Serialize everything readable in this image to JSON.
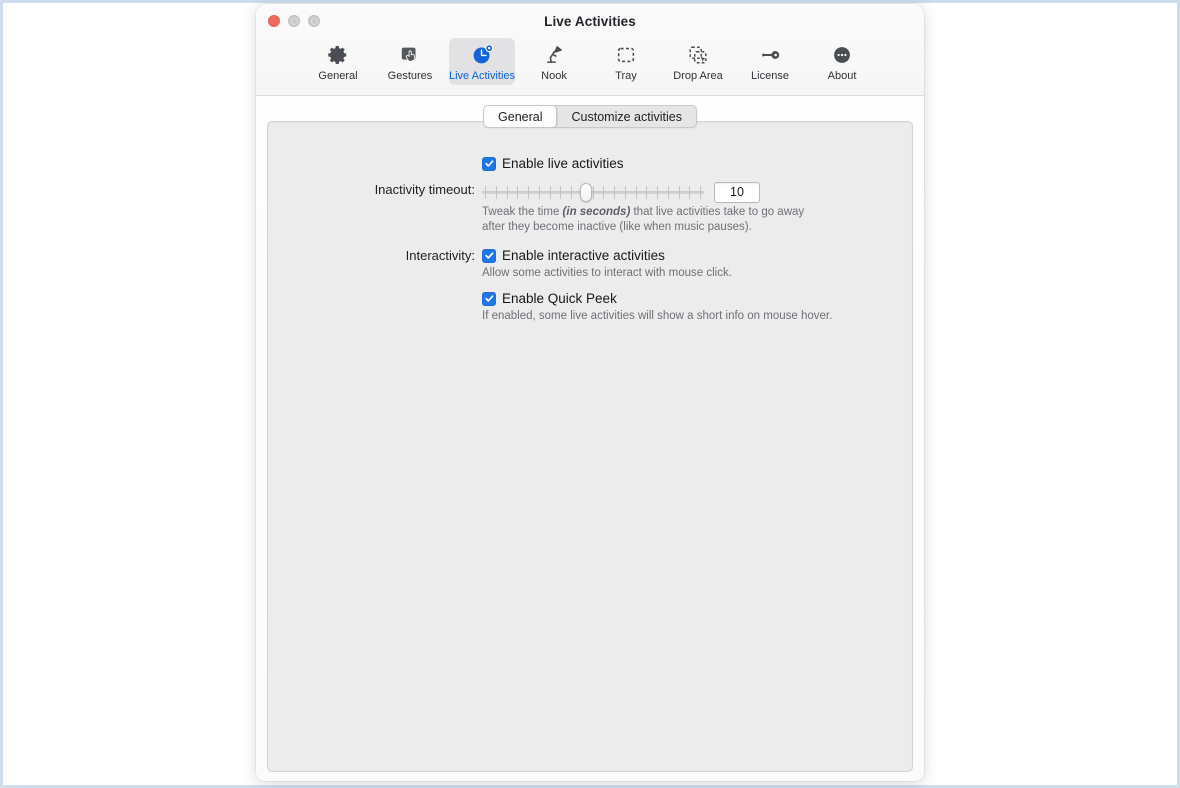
{
  "window": {
    "title": "Live Activities",
    "traffic_lights": [
      "close-button",
      "minimize-button",
      "zoom-button"
    ]
  },
  "toolbar": {
    "items": [
      {
        "label": "General",
        "icon": "gear-icon",
        "selected": false
      },
      {
        "label": "Gestures",
        "icon": "hand-gesture-icon",
        "selected": false
      },
      {
        "label": "Live Activities",
        "icon": "live-activity-clock-icon",
        "selected": true
      },
      {
        "label": "Nook",
        "icon": "desk-lamp-icon",
        "selected": false
      },
      {
        "label": "Tray",
        "icon": "dashed-square-icon",
        "selected": false
      },
      {
        "label": "Drop Area",
        "icon": "drop-area-icon",
        "selected": false
      },
      {
        "label": "License",
        "icon": "key-icon",
        "selected": false
      },
      {
        "label": "About",
        "icon": "ellipsis-circle-icon",
        "selected": false
      }
    ]
  },
  "tabs": [
    {
      "label": "General",
      "active": true
    },
    {
      "label": "Customize activities",
      "active": false
    }
  ],
  "settings": {
    "enable_live_activities": {
      "label": "Enable live activities",
      "checked": true
    },
    "inactivity_timeout": {
      "label": "Inactivity timeout:",
      "value": "10",
      "slider_percent": 47,
      "tick_count": 21,
      "hint_line1_a": "Tweak the time ",
      "hint_line1_em": "(in seconds)",
      "hint_line1_b": " that live activities take to go away",
      "hint_line2": "after they become inactive (like when music pauses)."
    },
    "interactivity": {
      "label": "Interactivity:",
      "enable_interactive": {
        "label": "Enable interactive activities",
        "checked": true,
        "hint": "Allow some activities to interact with mouse click."
      },
      "enable_quick_peek": {
        "label": "Enable Quick Peek",
        "checked": true,
        "hint": "If enabled, some live activities will show a short info on mouse hover."
      }
    }
  },
  "colors": {
    "accent": "#1f76e8",
    "selected_tab_text": "#0a62d0",
    "panel_bg": "#ececed",
    "page_border": "#cddded"
  }
}
